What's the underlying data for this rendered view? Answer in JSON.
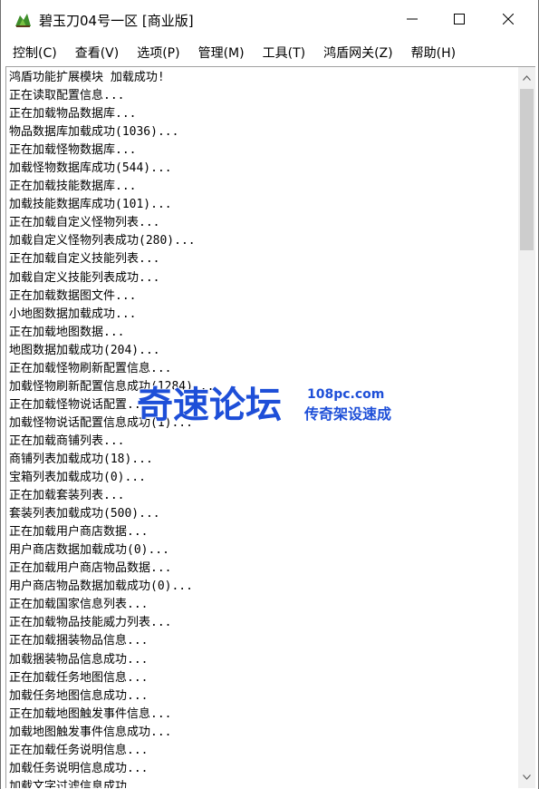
{
  "window": {
    "title": "碧玉刀04号一区 [商业版]"
  },
  "menu": [
    "控制(C)",
    "查看(V)",
    "选项(P)",
    "管理(M)",
    "工具(T)",
    "鸿盾网关(Z)",
    "帮助(H)"
  ],
  "log": [
    "鸿盾功能扩展模块 加载成功!",
    "正在读取配置信息...",
    "正在加载物品数据库...",
    "物品数据库加载成功(1036)...",
    "正在加载怪物数据库...",
    "加载怪物数据库成功(544)...",
    "正在加载技能数据库...",
    "加载技能数据库成功(101)...",
    "正在加载自定义怪物列表...",
    "加载自定义怪物列表成功(280)...",
    "正在加载自定义技能列表...",
    "加载自定义技能列表成功...",
    "正在加载数据图文件...",
    "小地图数据加载成功...",
    "正在加载地图数据...",
    "地图数据加载成功(204)...",
    "正在加载怪物刷新配置信息...",
    "加载怪物刷新配置信息成功(1284)...",
    "正在加载怪物说话配置...",
    "加载怪物说话配置信息成功(1)...",
    "正在加载商铺列表...",
    "商铺列表加载成功(18)...",
    "宝箱列表加载成功(0)...",
    "正在加载套装列表...",
    "套装列表加载成功(500)...",
    "正在加载用户商店数据...",
    "用户商店数据加载成功(0)...",
    "正在加载用户商店物品数据...",
    "用户商店物品数据加载成功(0)...",
    "正在加载国家信息列表...",
    "正在加载物品技能威力列表...",
    "正在加载捆装物品信息...",
    "加载捆装物品信息成功...",
    "正在加载任务地图信息...",
    "加载任务地图信息成功...",
    "正在加载地图触发事件信息...",
    "加载地图触发事件信息成功...",
    "正在加载任务说明信息...",
    "加载任务说明信息成功...",
    "加载文字过滤信息成功..."
  ],
  "watermark": {
    "main": "奇速论坛",
    "site": "108pc.com",
    "slogan": "传奇架设速成"
  },
  "icons": {
    "app": "green-tree-app-icon",
    "minimize": "minimize-icon",
    "maximize": "maximize-icon",
    "close": "close-icon",
    "scroll_up": "scroll-up-arrow-icon",
    "scroll_down": "scroll-down-arrow-icon"
  },
  "colors": {
    "watermark": "#1e4fd8",
    "titlebar": "#ffffff",
    "scroll_thumb": "#cdcdcd"
  }
}
